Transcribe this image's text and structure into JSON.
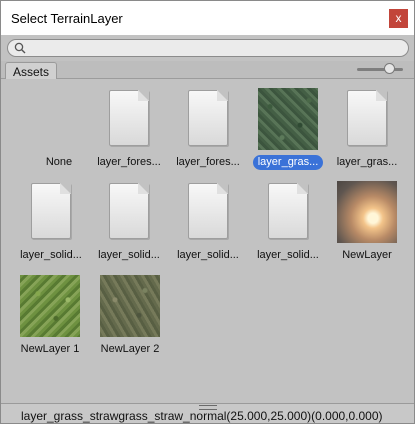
{
  "window": {
    "title": "Select TerrainLayer",
    "close_label": "x"
  },
  "search": {
    "placeholder": "",
    "value": ""
  },
  "tabs": {
    "assets": "Assets"
  },
  "thumbnail_size_slider": {
    "value": 0.6
  },
  "assets": [
    {
      "label": "None",
      "icon": "none",
      "selected": false
    },
    {
      "label": "layer_fores...",
      "icon": "document-icon",
      "selected": false
    },
    {
      "label": "layer_fores...",
      "icon": "document-icon",
      "selected": false
    },
    {
      "label": "layer_gras...",
      "icon": "grass-texture",
      "selected": true
    },
    {
      "label": "layer_gras...",
      "icon": "document-icon",
      "selected": false
    },
    {
      "label": "layer_solid...",
      "icon": "document-icon",
      "selected": false
    },
    {
      "label": "layer_solid...",
      "icon": "document-icon",
      "selected": false
    },
    {
      "label": "layer_solid...",
      "icon": "document-icon",
      "selected": false
    },
    {
      "label": "layer_solid...",
      "icon": "document-icon",
      "selected": false
    },
    {
      "label": "NewLayer",
      "icon": "sunset-texture",
      "selected": false
    },
    {
      "label": "NewLayer 1",
      "icon": "grass-texture-2",
      "selected": false
    },
    {
      "label": "NewLayer 2",
      "icon": "dirt-texture",
      "selected": false
    }
  ],
  "status": {
    "text": "layer_grass_strawgrass_straw_normal(25.000,25.000)(0.000,0.000)"
  },
  "colors": {
    "selection": "#3a72d8",
    "close_button": "#c2453a",
    "background": "#c2c2c2"
  }
}
